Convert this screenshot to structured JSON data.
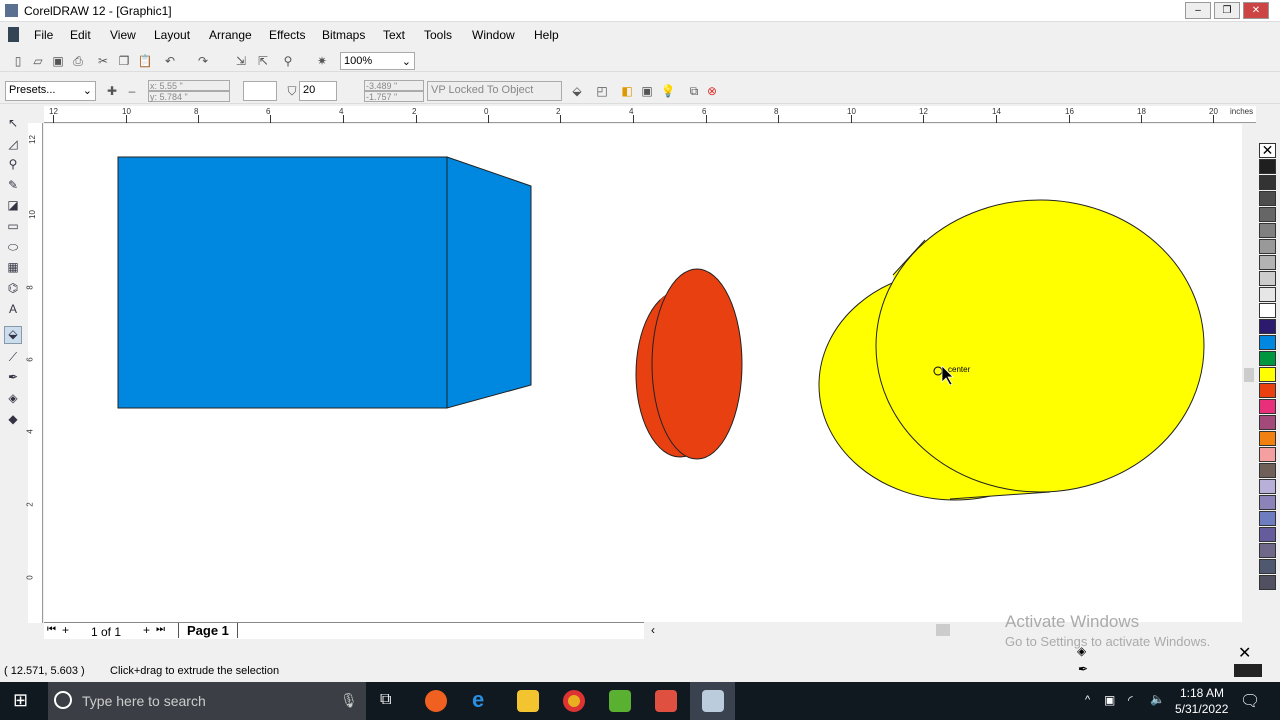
{
  "window": {
    "title": "CorelDRAW 12 - [Graphic1]"
  },
  "menu": [
    "File",
    "Edit",
    "View",
    "Layout",
    "Arrange",
    "Effects",
    "Bitmaps",
    "Text",
    "Tools",
    "Window",
    "Help"
  ],
  "toolbar": {
    "zoom": "100%"
  },
  "propbar": {
    "presets": "Presets...",
    "x": "x: 5.55 \"",
    "y": "y: 5.784 \"",
    "depth": "20",
    "vp_x": "-3.489 \"",
    "vp_y": "-1.757 \"",
    "vp_mode": "VP Locked To Object"
  },
  "ruler": {
    "h_labels": [
      "12",
      "10",
      "8",
      "6",
      "4",
      "2",
      "0",
      "2",
      "4",
      "6",
      "8",
      "10",
      "12",
      "14",
      "16",
      "18",
      "20"
    ],
    "unit": "inches",
    "v_labels": [
      "12",
      "10",
      "8",
      "6",
      "4",
      "2",
      "0"
    ]
  },
  "canvas": {
    "cursor_label": "center"
  },
  "palette": [
    "#1f1f1f",
    "#333333",
    "#4d4d4d",
    "#666666",
    "#808080",
    "#999999",
    "#b3b3b3",
    "#cccccc",
    "#e6e6e6",
    "#ffffff",
    "#2b1a6e",
    "#0088e0",
    "#00963f",
    "#ffff00",
    "#e84010",
    "#e8307a",
    "#a44a7a",
    "#f08010",
    "#f4a0a0",
    "#6e6058",
    "#b8b0d8",
    "#8c84b8",
    "#6e7cc0",
    "#645c9c",
    "#706888",
    "#505870",
    "#505060"
  ],
  "pagebar": {
    "page_count": "1 of 1",
    "page_tab": "Page 1"
  },
  "status": {
    "coords": "( 12.571, 5.603 )",
    "hint": "Click+drag to extrude the selection"
  },
  "watermark": {
    "title": "Activate Windows",
    "sub": "Go to Settings to activate Windows."
  },
  "taskbar": {
    "search_placeholder": "Type here to search",
    "time": "1:18 AM",
    "date": "5/31/2022"
  }
}
